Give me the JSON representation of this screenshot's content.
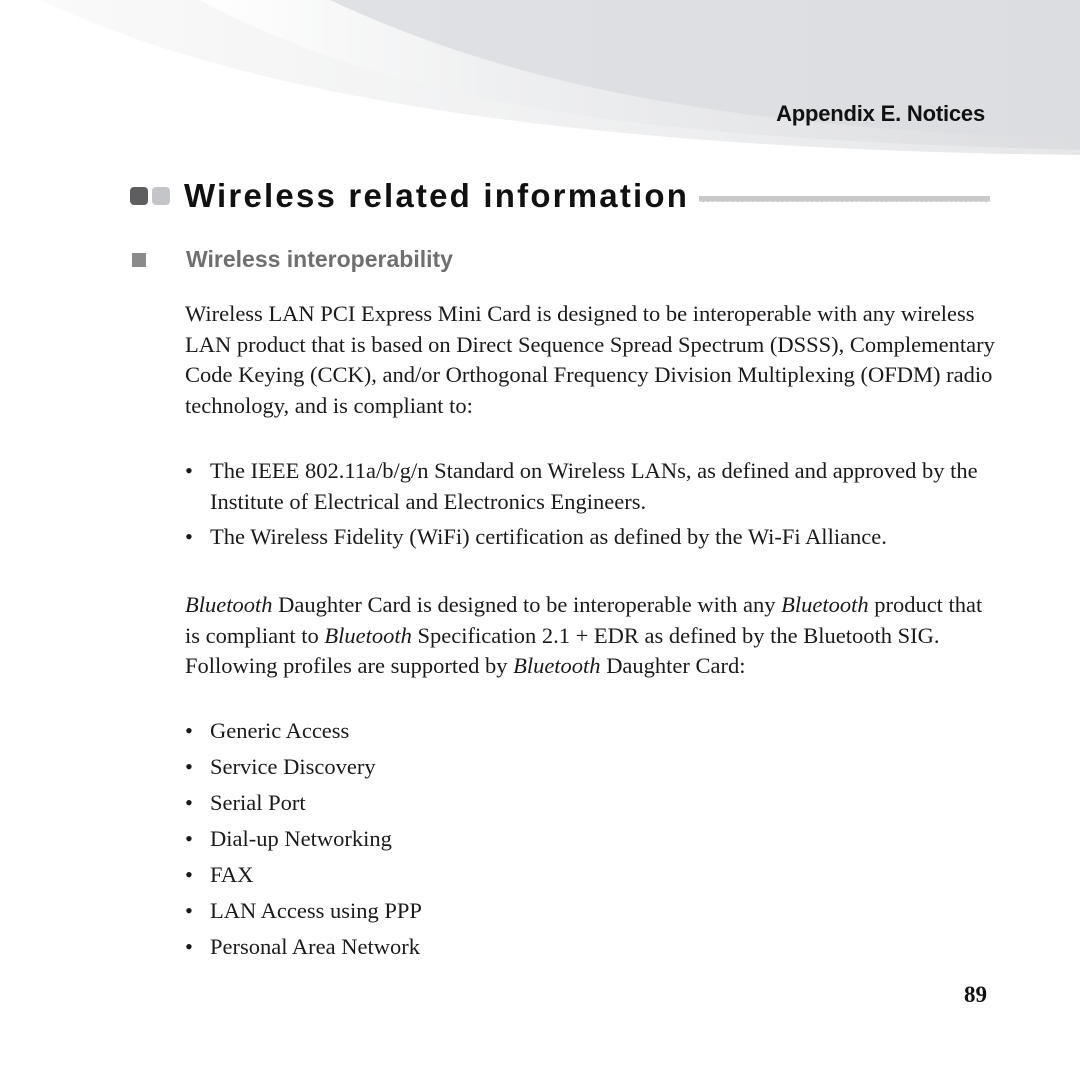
{
  "header": {
    "running_head": "Appendix E. Notices"
  },
  "section": {
    "title": "Wireless related information",
    "subsection_title": "Wireless interoperability"
  },
  "content": {
    "paragraph_1": "Wireless LAN PCI Express Mini Card is designed to be interoperable with any wireless LAN product that is based on Direct Sequence Spread Spectrum (DSSS), Complementary Code Keying (CCK), and/or Orthogonal Frequency Division Multiplexing (OFDM) radio technology, and is compliant to:",
    "compliance_list": [
      "The IEEE 802.11a/b/g/n Standard on Wireless LANs, as defined and approved by the Institute of Electrical and Electronics Engineers.",
      "The Wireless Fidelity (WiFi) certification as defined by the Wi-Fi Alliance."
    ],
    "paragraph_2": {
      "bt1": "Bluetooth",
      "t1": " Daughter Card is designed to be interoperable with any ",
      "bt2": "Bluetooth",
      "t2": " product that is compliant to ",
      "bt3": "Bluetooth",
      "t3": " Specification 2.1 + EDR as defined by the Bluetooth SIG. Following profiles are supported by ",
      "bt4": "Bluetooth",
      "t4": " Daughter Card:"
    },
    "profiles_list": [
      "Generic Access",
      "Service Discovery",
      "Serial Port",
      "Dial-up Networking",
      "FAX",
      "LAN Access using PPP",
      "Personal Area Network"
    ]
  },
  "footer": {
    "page_number": "89"
  },
  "colors": {
    "title_square_dark": "#5e5e60",
    "title_square_light": "#c4c5c9",
    "subsection_text": "#6f6f6f",
    "header_swoosh": "#dcdde0"
  }
}
